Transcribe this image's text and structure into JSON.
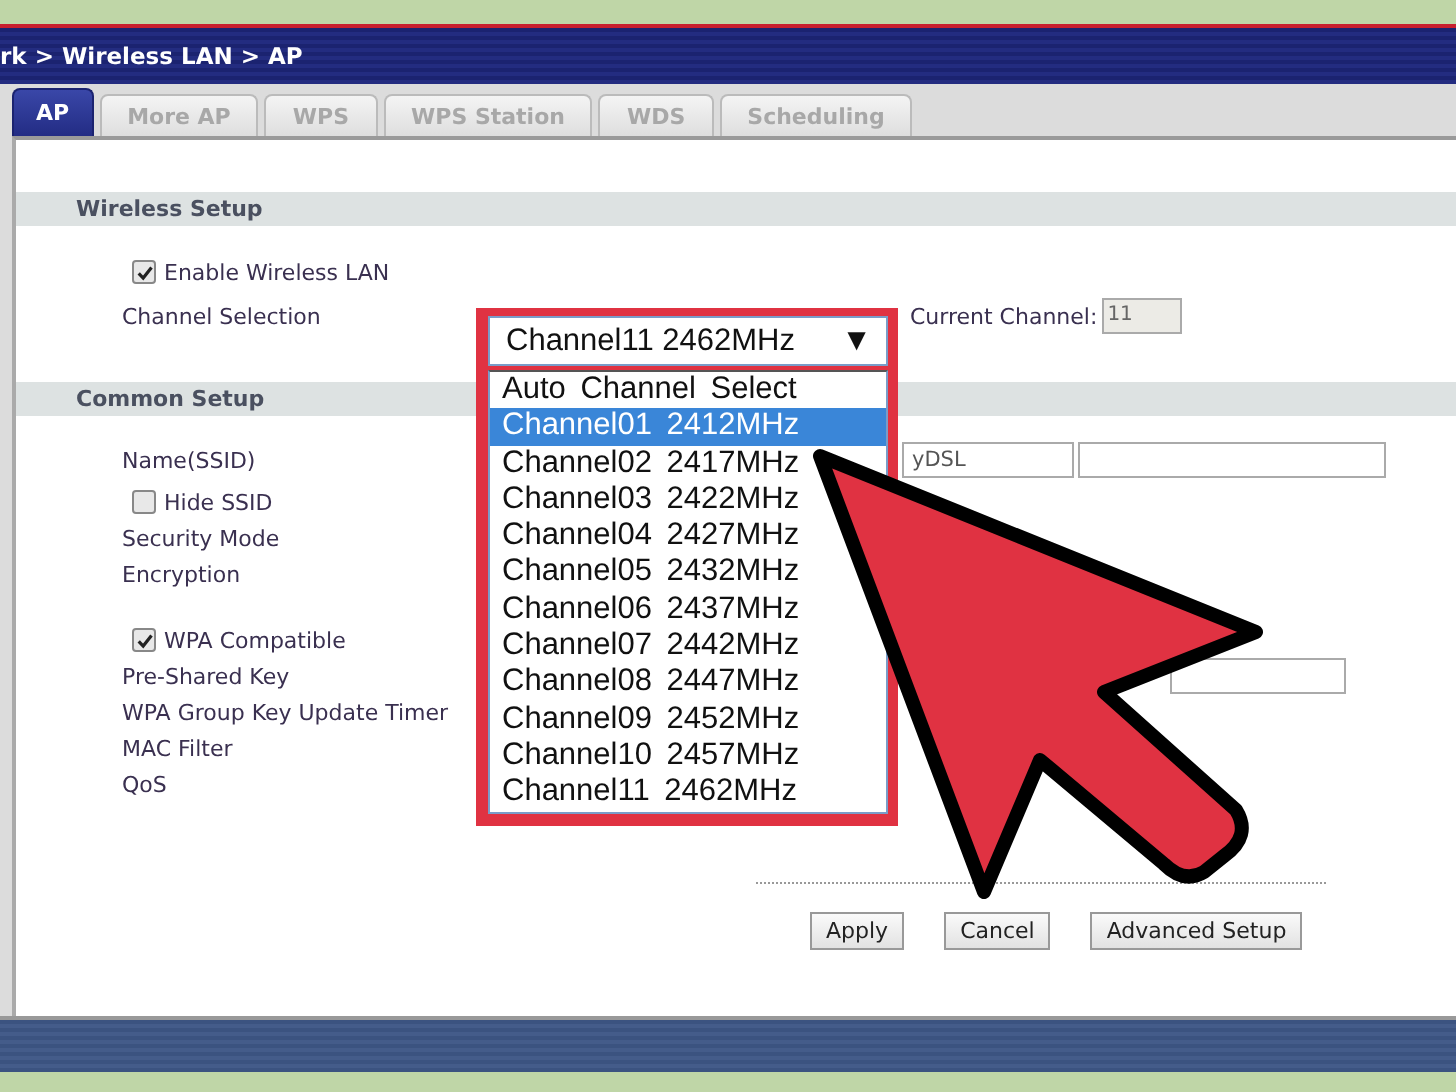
{
  "breadcrumb": "rk > Wireless LAN > AP",
  "tabs": [
    {
      "label": "AP",
      "selected": true
    },
    {
      "label": "More AP",
      "selected": false
    },
    {
      "label": "WPS",
      "selected": false
    },
    {
      "label": "WPS Station",
      "selected": false
    },
    {
      "label": "WDS",
      "selected": false
    },
    {
      "label": "Scheduling",
      "selected": false
    }
  ],
  "wireless_setup": {
    "title": "Wireless Setup",
    "enable": {
      "label": "Enable Wireless LAN",
      "checked": true
    },
    "channel_label": "Channel Selection",
    "current_channel_label": "Current Channel:",
    "current_channel": "11"
  },
  "channel_dropdown": {
    "value": "Channel11 2462MHz",
    "arrow": "▼",
    "options": [
      {
        "label": "Auto Channel Select",
        "highlighted": false
      },
      {
        "label": "Channel01 2412MHz",
        "highlighted": true
      },
      {
        "label": "Channel02 2417MHz",
        "highlighted": false
      },
      {
        "label": "Channel03 2422MHz",
        "highlighted": false
      },
      {
        "label": "Channel04 2427MHz",
        "highlighted": false
      },
      {
        "label": "Channel05 2432MHz",
        "highlighted": false
      },
      {
        "label": "Channel06 2437MHz",
        "highlighted": false
      },
      {
        "label": "Channel07 2442MHz",
        "highlighted": false
      },
      {
        "label": "Channel08 2447MHz",
        "highlighted": false
      },
      {
        "label": "Channel09 2452MHz",
        "highlighted": false
      },
      {
        "label": "Channel10 2457MHz",
        "highlighted": false
      },
      {
        "label": "Channel11 2462MHz",
        "highlighted": false
      }
    ]
  },
  "common_setup": {
    "title": "Common Setup",
    "ssid_label": "Name(SSID)",
    "ssid_value": "yDSL",
    "hide_ssid": {
      "label": "Hide SSID",
      "checked": false
    },
    "security_label": "Security Mode",
    "encryption_label": "Encryption",
    "wpa": {
      "label": "WPA Compatible",
      "checked": true
    },
    "psk_label": "Pre-Shared Key",
    "timer_label": "WPA Group Key Update Timer",
    "mac_label": "MAC Filter",
    "qos_label": "QoS"
  },
  "buttons": [
    "Apply",
    "Cancel",
    "Advanced Setup"
  ]
}
